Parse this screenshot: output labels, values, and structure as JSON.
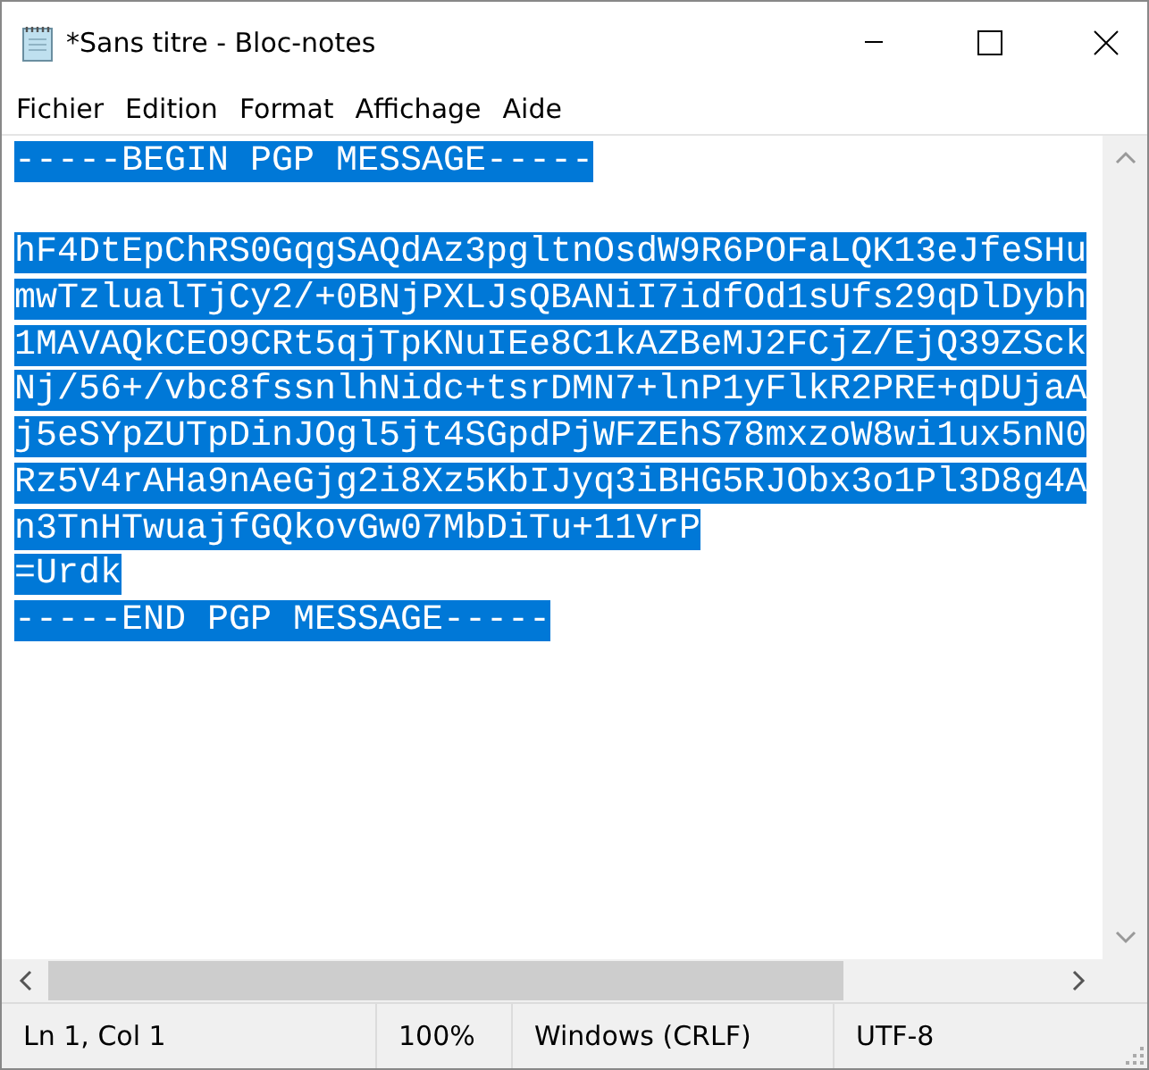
{
  "window": {
    "title": "*Sans titre - Bloc-notes"
  },
  "menu": [
    "Fichier",
    "Edition",
    "Format",
    "Affichage",
    "Aide"
  ],
  "editor": {
    "selected": true,
    "lines": [
      "-----BEGIN PGP MESSAGE-----"
    ],
    "body_lines": [
      "hF4DtEpChRS0GqgSAQdAz3pgltnOsdW9R6POFaLQK13eJfeSHu",
      "mwTzlualTjCy2/+0BNjPXLJsQBANiI7idfOd1sUfs29qDlDybh",
      "1MAVAQkCEO9CRt5qjTpKNuIEe8C1kAZBeMJ2FCjZ/EjQ39ZSck",
      "Nj/56+/vbc8fssnlhNidc+tsrDMN7+lnP1yFlkR2PRE+qDUjaA",
      "j5eSYpZUTpDinJOgl5jt4SGpdPjWFZEhS78mxzoW8wi1ux5nN0",
      "Rz5V4rAHa9nAeGjg2i8Xz5KbIJyq3iBHG5RJObx3o1Pl3D8g4A",
      "n3TnHTwuajfGQkovGw07MbDiTu+11VrP",
      "=Urdk",
      "-----END PGP MESSAGE-----"
    ]
  },
  "status_bar": [
    "Ln 1, Col 1",
    "100%",
    "Windows (CRLF)",
    "UTF-8"
  ]
}
